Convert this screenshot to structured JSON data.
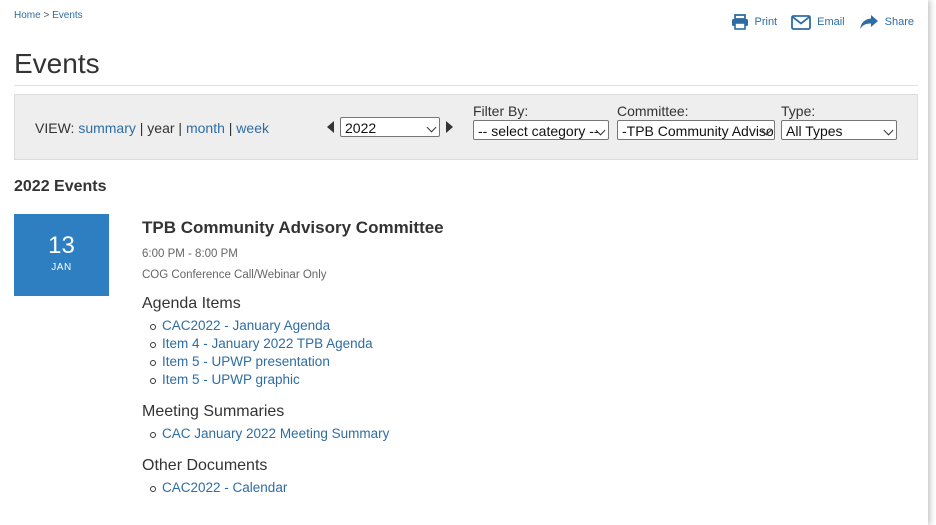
{
  "breadcrumb": {
    "home": "Home",
    "separator": ">",
    "current": "Events"
  },
  "toolbar": {
    "print": "Print",
    "email": "Email",
    "share": "Share"
  },
  "page": {
    "title": "Events"
  },
  "view": {
    "label": "VIEW:",
    "summary": "summary",
    "year": "year",
    "month": "month",
    "week": "week",
    "separator": "|"
  },
  "year_select": {
    "value": "2022"
  },
  "filters": {
    "filter_by": {
      "label": "Filter By:",
      "value": "-- select category --"
    },
    "committee": {
      "label": "Committee:",
      "value": "-TPB Community Advisory Committee"
    },
    "type": {
      "label": "Type:",
      "value": "All Types"
    }
  },
  "events_heading": "2022 Events",
  "event": {
    "day": "13",
    "month": "JAN",
    "title": "TPB Community Advisory Committee",
    "time": "6:00 PM - 8:00 PM",
    "location": "COG Conference Call/Webinar Only",
    "agenda_heading": "Agenda Items",
    "agenda_items": [
      "CAC2022 - January Agenda",
      "Item 4 - January 2022 TPB Agenda",
      "Item 5 - UPWP presentation",
      "Item 5 - UPWP graphic"
    ],
    "summaries_heading": "Meeting Summaries",
    "summary_items": [
      "CAC January 2022 Meeting Summary"
    ],
    "other_heading": "Other Documents",
    "other_items": [
      "CAC2022 - Calendar"
    ]
  },
  "colors": {
    "accent": "#2e7fc1",
    "link": "#2e6da4",
    "filter_bg": "#eeeeee"
  }
}
